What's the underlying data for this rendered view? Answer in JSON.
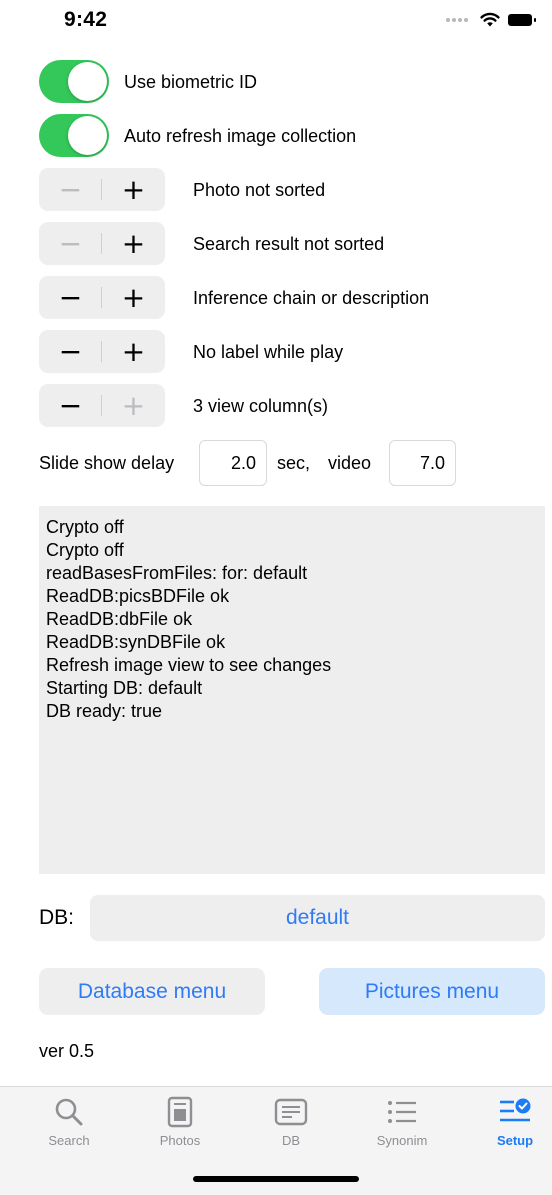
{
  "status_bar": {
    "time": "9:42"
  },
  "settings": {
    "toggles": [
      {
        "label": "Use biometric ID",
        "on": true
      },
      {
        "label": "Auto refresh image collection",
        "on": true
      }
    ],
    "steppers": [
      {
        "label": "Photo not sorted",
        "minus_enabled": false,
        "plus_enabled": true
      },
      {
        "label": "Search result not sorted",
        "minus_enabled": false,
        "plus_enabled": true
      },
      {
        "label": "Inference chain or description",
        "minus_enabled": true,
        "plus_enabled": true
      },
      {
        "label": "No label while play",
        "minus_enabled": true,
        "plus_enabled": true
      },
      {
        "label": "3 view column(s)",
        "minus_enabled": true,
        "plus_enabled": false
      }
    ],
    "slide_show": {
      "label": "Slide show delay",
      "delay_value": "2.0",
      "sec_label": "sec,",
      "video_label": "video",
      "video_value": "7.0"
    }
  },
  "log": {
    "lines": [
      "Crypto off",
      "Crypto off",
      "readBasesFromFiles: for: default",
      "ReadDB:picsBDFile ok",
      "ReadDB:dbFile ok",
      "ReadDB:synDBFile ok",
      "Refresh image view to see changes",
      "Starting DB: default",
      "DB ready: true"
    ]
  },
  "db": {
    "label": "DB:",
    "value": "default"
  },
  "buttons": {
    "database_menu": "Database menu",
    "pictures_menu": "Pictures menu"
  },
  "version": "ver 0.5",
  "tab_bar": {
    "tabs": [
      {
        "label": "Search",
        "icon": "search-icon",
        "active": false
      },
      {
        "label": "Photos",
        "icon": "photos-icon",
        "active": false
      },
      {
        "label": "DB",
        "icon": "db-icon",
        "active": false
      },
      {
        "label": "Synonim",
        "icon": "list-icon",
        "active": false
      },
      {
        "label": "Setup",
        "icon": "setup-checklist-icon",
        "active": true
      }
    ]
  },
  "colors": {
    "toggle_on": "#34c759",
    "accent": "#2f7bf6",
    "inactive_tab": "#8e8e93",
    "pictures_button_bg": "#d6e8fb"
  }
}
